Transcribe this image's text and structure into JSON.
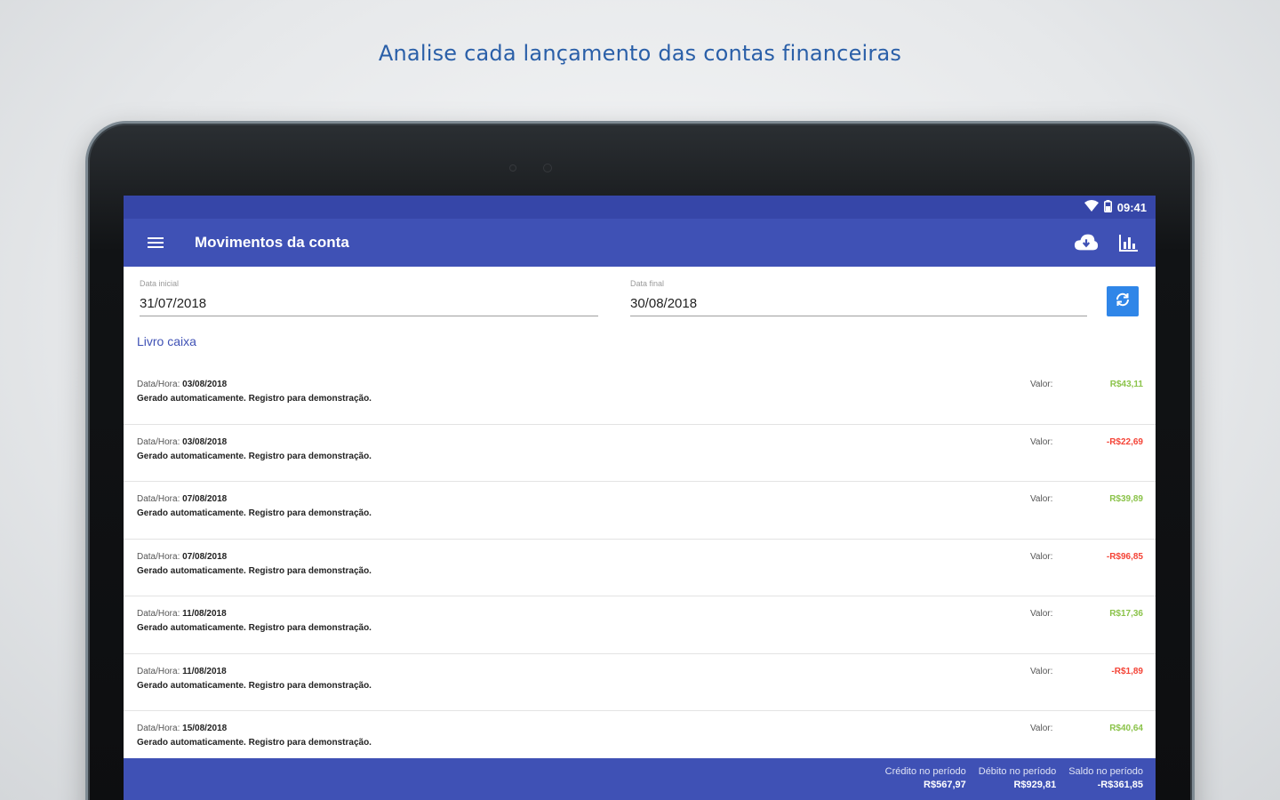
{
  "caption": "Analise cada lançamento das contas financeiras",
  "status_bar": {
    "time": "09:41",
    "icons": [
      "wifi-icon",
      "battery-icon"
    ]
  },
  "app_bar": {
    "title": "Movimentos da conta",
    "icons": [
      "menu-icon",
      "cloud-download-icon",
      "chart-icon"
    ]
  },
  "filters": {
    "start_label": "Data inicial",
    "start_value": "31/07/2018",
    "end_label": "Data final",
    "end_value": "30/08/2018",
    "refresh_icon": "refresh-icon"
  },
  "section_title": "Livro caixa",
  "entries": [
    {
      "date_label": "Data/Hora:",
      "date": "03/08/2018",
      "description": "Gerado automaticamente. Registro para demonstração.",
      "value_label": "Valor:",
      "amount": "R$43,11",
      "sign": "positive"
    },
    {
      "date_label": "Data/Hora:",
      "date": "03/08/2018",
      "description": "Gerado automaticamente. Registro para demonstração.",
      "value_label": "Valor:",
      "amount": "-R$22,69",
      "sign": "negative"
    },
    {
      "date_label": "Data/Hora:",
      "date": "07/08/2018",
      "description": "Gerado automaticamente. Registro para demonstração.",
      "value_label": "Valor:",
      "amount": "R$39,89",
      "sign": "positive"
    },
    {
      "date_label": "Data/Hora:",
      "date": "07/08/2018",
      "description": "Gerado automaticamente. Registro para demonstração.",
      "value_label": "Valor:",
      "amount": "-R$96,85",
      "sign": "negative"
    },
    {
      "date_label": "Data/Hora:",
      "date": "11/08/2018",
      "description": "Gerado automaticamente. Registro para demonstração.",
      "value_label": "Valor:",
      "amount": "R$17,36",
      "sign": "positive"
    },
    {
      "date_label": "Data/Hora:",
      "date": "11/08/2018",
      "description": "Gerado automaticamente. Registro para demonstração.",
      "value_label": "Valor:",
      "amount": "-R$1,89",
      "sign": "negative"
    },
    {
      "date_label": "Data/Hora:",
      "date": "15/08/2018",
      "description": "Gerado automaticamente. Registro para demonstração.",
      "value_label": "Valor:",
      "amount": "R$40,64",
      "sign": "positive"
    }
  ],
  "footer": {
    "credit_label": "Crédito no período",
    "credit_value": "R$567,97",
    "debit_label": "Débito no período",
    "debit_value": "R$929,81",
    "balance_label": "Saldo no período",
    "balance_value": "-R$361,85"
  },
  "colors": {
    "primary": "#3f51b5",
    "status_bar": "#3646a8",
    "accent": "#2f86e8",
    "positive": "#8bc34a",
    "negative": "#f44336",
    "caption": "#2a5fa8"
  }
}
